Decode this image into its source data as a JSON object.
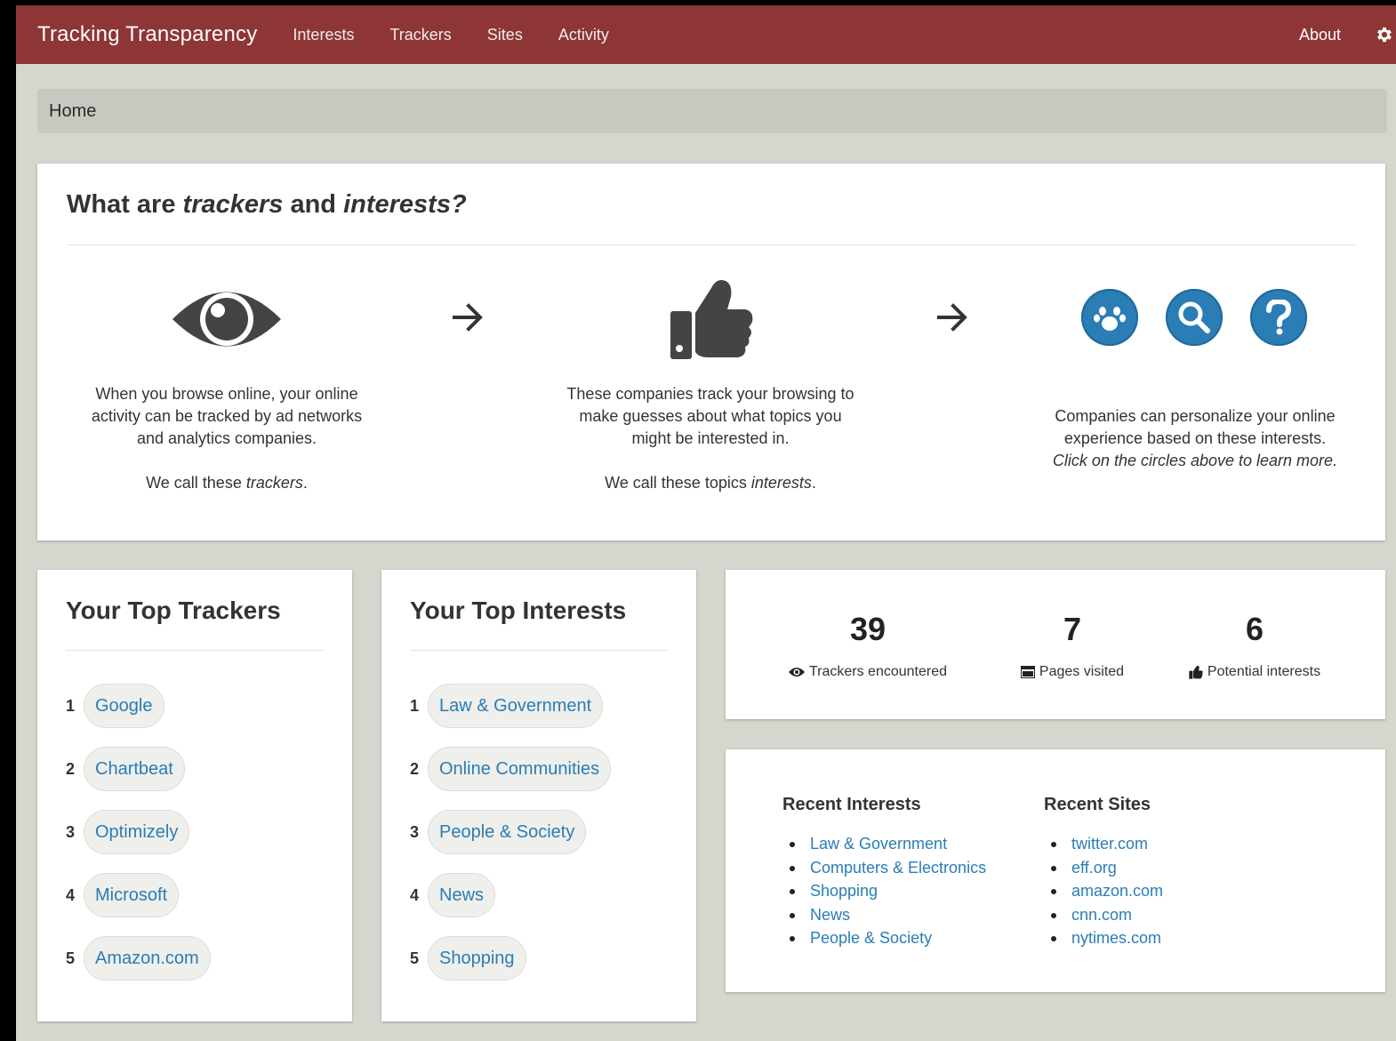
{
  "navbar": {
    "brand": "Tracking Transparency",
    "links": [
      "Interests",
      "Trackers",
      "Sites",
      "Activity"
    ],
    "about": "About"
  },
  "breadcrumb": "Home",
  "intro": {
    "title_parts": [
      "What are ",
      "trackers",
      " and ",
      "interests?"
    ],
    "col1": {
      "text_lines": [
        "When you browse online, your online",
        "activity can be tracked by ad networks",
        "and analytics companies."
      ],
      "call_prefix": "We call these ",
      "call_em": "trackers",
      "call_suffix": "."
    },
    "col2": {
      "text_lines": [
        "These companies track your browsing to",
        "make guesses about what topics you",
        "might be interested in."
      ],
      "call_prefix": "We call these topics ",
      "call_em": "interests",
      "call_suffix": "."
    },
    "col3": {
      "text_lines": [
        "Companies can personalize your online",
        "experience based on these interests."
      ],
      "em_line": "Click on the circles above to learn more."
    },
    "icons": [
      "eye-icon",
      "thumbs-up-icon",
      "paw-icon",
      "search-icon",
      "question-icon"
    ]
  },
  "top_trackers": {
    "title": "Your Top Trackers",
    "items": [
      {
        "rank": "1",
        "name": "Google"
      },
      {
        "rank": "2",
        "name": "Chartbeat"
      },
      {
        "rank": "3",
        "name": "Optimizely"
      },
      {
        "rank": "4",
        "name": "Microsoft"
      },
      {
        "rank": "5",
        "name": "Amazon.com"
      }
    ]
  },
  "top_interests": {
    "title": "Your Top Interests",
    "items": [
      {
        "rank": "1",
        "name": "Law & Government"
      },
      {
        "rank": "2",
        "name": "Online Communities"
      },
      {
        "rank": "3",
        "name": "People & Society"
      },
      {
        "rank": "4",
        "name": "News"
      },
      {
        "rank": "5",
        "name": "Shopping"
      }
    ]
  },
  "stats": [
    {
      "value": "39",
      "label": "Trackers encountered",
      "icon": "eye-icon"
    },
    {
      "value": "7",
      "label": "Pages visited",
      "icon": "window-icon"
    },
    {
      "value": "6",
      "label": "Potential interests",
      "icon": "thumbs-up-icon"
    }
  ],
  "recent": {
    "interests_title": "Recent Interests",
    "interests": [
      "Law & Government",
      "Computers & Electronics",
      "Shopping",
      "News",
      "People & Society"
    ],
    "sites_title": "Recent Sites",
    "sites": [
      "twitter.com",
      "eff.org",
      "amazon.com",
      "cnn.com",
      "nytimes.com"
    ]
  },
  "colors": {
    "navbar": "#8e3535",
    "background": "#d6d6ce",
    "link": "#2a7db5",
    "icon_dark": "#444444"
  }
}
